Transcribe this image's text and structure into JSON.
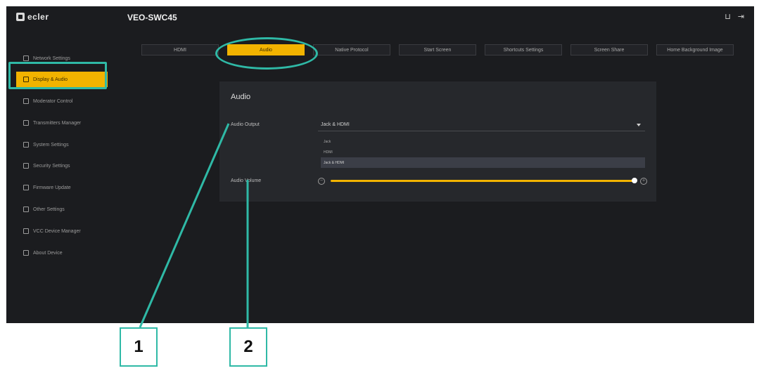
{
  "header": {
    "logo": "ecler",
    "device_title": "VEO-SWC45",
    "icon_right_1": "tray-icon",
    "icon_right_2": "logout-icon"
  },
  "sidebar": {
    "items": [
      {
        "label": "Network Settings",
        "icon": "network-icon"
      },
      {
        "label": "Display & Audio",
        "icon": "display-icon",
        "active": true
      },
      {
        "label": "Moderator Control",
        "icon": "moderator-icon"
      },
      {
        "label": "Transmitters Manager",
        "icon": "transmitter-icon"
      },
      {
        "label": "System Settings",
        "icon": "gear-icon"
      },
      {
        "label": "Security Settings",
        "icon": "lock-icon"
      },
      {
        "label": "Firmware Update",
        "icon": "upload-icon"
      },
      {
        "label": "Other Settings",
        "icon": "sliders-icon"
      },
      {
        "label": "VCC Device Manager",
        "icon": "device-icon"
      },
      {
        "label": "About Device",
        "icon": "info-icon"
      }
    ]
  },
  "tabs": [
    {
      "label": "HDMI"
    },
    {
      "label": "Audio",
      "active": true
    },
    {
      "label": "Native Protocol"
    },
    {
      "label": "Start Screen"
    },
    {
      "label": "Shortcuts Settings"
    },
    {
      "label": "Screen Share"
    },
    {
      "label": "Home Background Image"
    }
  ],
  "audio": {
    "title": "Audio",
    "output_label": "Audio Output",
    "output_value": "Jack & HDMI",
    "options": [
      "Jack",
      "HDMI",
      "Jack & HDMI"
    ],
    "volume_label": "Audio Volume",
    "volume_level": 1.0
  },
  "callouts": [
    "1",
    "2"
  ],
  "colors": {
    "accent": "#f2b300",
    "annotation": "#2fb9a6",
    "background": "#1b1c1f",
    "panel": "#26282c"
  }
}
